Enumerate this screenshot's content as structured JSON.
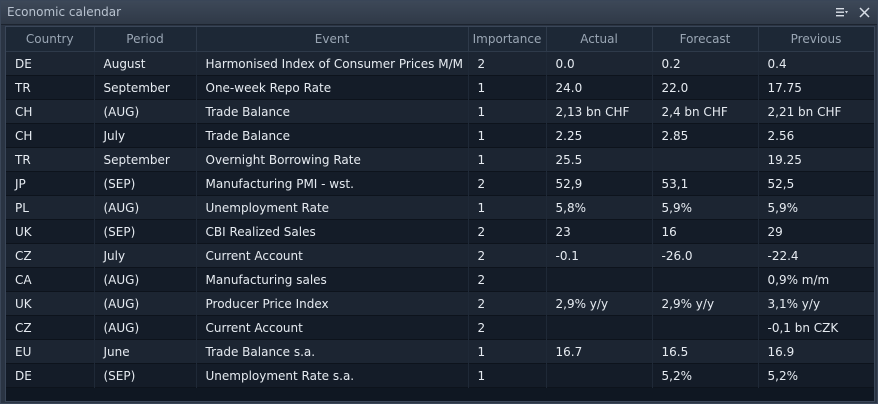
{
  "window": {
    "title": "Economic calendar"
  },
  "icons": {
    "menu": "settings-menu-icon",
    "close": "close-icon"
  },
  "colors": {
    "header_text": "#9aa6b4",
    "row_text": "#e6ebf1",
    "row_odd": "#1c2532",
    "row_even": "#141c28"
  },
  "table": {
    "columns": [
      "Country",
      "Period",
      "Event",
      "Importance",
      "Actual",
      "Forecast",
      "Previous"
    ],
    "rows": [
      [
        "DE",
        "August",
        "Harmonised Index of Consumer Prices M/M",
        "2",
        "0.0",
        "0.2",
        "0.4"
      ],
      [
        "TR",
        "September",
        "One-week Repo Rate",
        "1",
        "24.0",
        "22.0",
        "17.75"
      ],
      [
        "CH",
        "(AUG)",
        "Trade Balance",
        "1",
        "2,13 bn CHF",
        "2,4 bn CHF",
        "2,21 bn CHF"
      ],
      [
        "CH",
        "July",
        "Trade Balance",
        "1",
        "2.25",
        "2.85",
        "2.56"
      ],
      [
        "TR",
        "September",
        "Overnight Borrowing Rate",
        "1",
        "25.5",
        "",
        "19.25"
      ],
      [
        "JP",
        "(SEP)",
        "Manufacturing PMI - wst.",
        "2",
        "52,9",
        "53,1",
        "52,5"
      ],
      [
        "PL",
        "(AUG)",
        "Unemployment Rate",
        "1",
        "5,8%",
        "5,9%",
        "5,9%"
      ],
      [
        "UK",
        "(SEP)",
        "CBI Realized Sales",
        "2",
        "23",
        "16",
        "29"
      ],
      [
        "CZ",
        "July",
        "Current Account",
        "2",
        "-0.1",
        "-26.0",
        "-22.4"
      ],
      [
        "CA",
        "(AUG)",
        "Manufacturing sales",
        "2",
        "",
        "",
        "0,9% m/m"
      ],
      [
        "UK",
        "(AUG)",
        "Producer Price Index",
        "2",
        "2,9% y/y",
        "2,9% y/y",
        "3,1% y/y"
      ],
      [
        "CZ",
        "(AUG)",
        "Current Account",
        "2",
        "",
        "",
        "-0,1 bn CZK"
      ],
      [
        "EU",
        "June",
        "Trade Balance s.a.",
        "1",
        "16.7",
        "16.5",
        "16.9"
      ],
      [
        "DE",
        "(SEP)",
        "Unemployment Rate s.a.",
        "1",
        "",
        "5,2%",
        "5,2%"
      ]
    ]
  }
}
